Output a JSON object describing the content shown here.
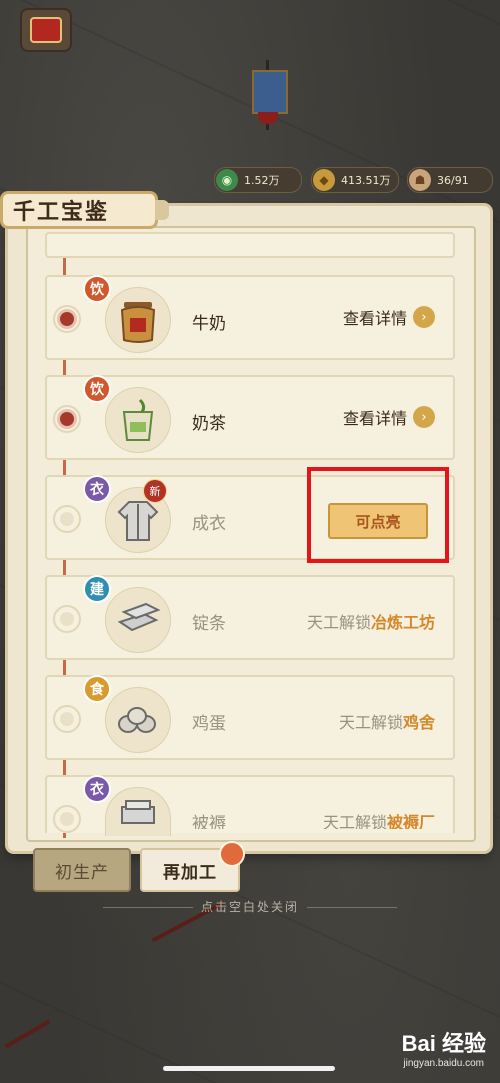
{
  "resources": [
    {
      "icon": "jade-coin-icon",
      "value": "1.52万"
    },
    {
      "icon": "gold-coin-icon",
      "value": "413.51万"
    },
    {
      "icon": "population-icon",
      "value": "36/91"
    }
  ],
  "panel": {
    "title": "千工宝鉴"
  },
  "items": [
    {
      "category": "饮",
      "category_name": "drink",
      "name": "牛奶",
      "action": "查看详情",
      "state": "detail"
    },
    {
      "category": "饮",
      "category_name": "drink",
      "name": "奶茶",
      "action": "查看详情",
      "state": "detail"
    },
    {
      "category": "衣",
      "category_name": "cloth",
      "name": "成衣",
      "badge": "新",
      "action": "可点亮",
      "state": "lightable"
    },
    {
      "category": "建",
      "category_name": "build",
      "name": "锭条",
      "unlock_prefix": "天工解锁",
      "unlock_target": "冶炼工坊",
      "state": "locked"
    },
    {
      "category": "食",
      "category_name": "food",
      "name": "鸡蛋",
      "unlock_prefix": "天工解锁",
      "unlock_target": "鸡舍",
      "state": "locked"
    },
    {
      "category": "衣",
      "category_name": "cloth",
      "name": "被褥",
      "unlock_prefix": "天工解锁",
      "unlock_target": "被褥厂",
      "state": "locked"
    }
  ],
  "tabs": {
    "primary": "初生产",
    "secondary": "再加工"
  },
  "close_hint": "点击空白处关闭",
  "watermark": {
    "brand": "Bai 经验",
    "url": "jingyan.baidu.com"
  },
  "colors": {
    "highlight": "#e3141a",
    "accent": "#d5882b",
    "drink": "#d2572b",
    "cloth": "#7a5aa8",
    "build": "#2f8fb0",
    "food": "#d79b2e"
  }
}
